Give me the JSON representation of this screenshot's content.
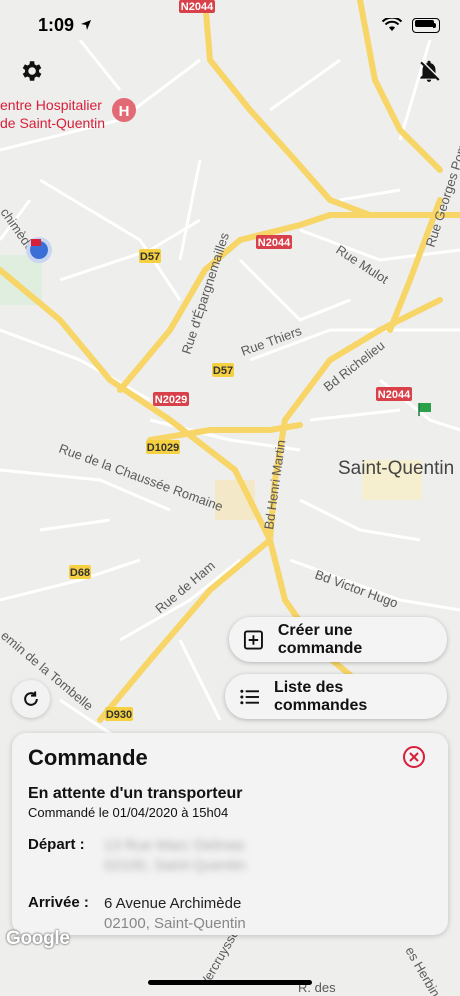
{
  "status_bar": {
    "time": "1:09"
  },
  "map": {
    "labels": {
      "hospital_line1": "entre Hospitalier",
      "hospital_line2": "de Saint-Quentin",
      "city": "Saint-Quentin",
      "rue_georges": "Rue Georges Pompidou",
      "rue_mulot": "Rue Mulot",
      "rue_thiers": "Rue Thiers",
      "rue_epargnemailles": "Rue d'Épargnemailles",
      "bd_richelieu": "Bd Richelieu",
      "bd_henri_martin": "Bd Henri Martin",
      "bd_victor_hugo": "Bd Victor Hugo",
      "chaussee_romaine": "Rue de la Chaussée Romaine",
      "rue_ham": "Rue de Ham",
      "tombelle": "emin de la Tombelle",
      "archimede": "chimède",
      "vercruysse": "Vercruysse",
      "herbin": "es Herbin",
      "r_des": "R. des"
    },
    "badges": {
      "n2044_top": "N2044",
      "n2044_mid": "N2044",
      "n2044_right": "N2044",
      "d57_a": "D57",
      "d57_b": "D57",
      "n2029": "N2029",
      "d1029": "D1029",
      "d68": "D68",
      "d930": "D930"
    },
    "google_logo": "Google"
  },
  "buttons": {
    "create_order": "Créer une commande",
    "order_list": "Liste des commandes"
  },
  "order_card": {
    "title": "Commande",
    "status": "En attente d'un transporteur",
    "ordered_at": "Commandé le 01/04/2020 à 15h04",
    "departure_label": "Départ :",
    "departure_line1": "13 Rue Marc Delmas",
    "departure_line2": "02100, Saint-Quentin",
    "arrival_label": "Arrivée :",
    "arrival_line1": "6 Avenue Archimède",
    "arrival_line2": "02100, Saint-Quentin"
  },
  "colors": {
    "accent_red": "#d6203a",
    "highway_yellow": "#f7d566",
    "route_badge_red": "#d9414a",
    "route_badge_yellow": "#f5d040"
  }
}
